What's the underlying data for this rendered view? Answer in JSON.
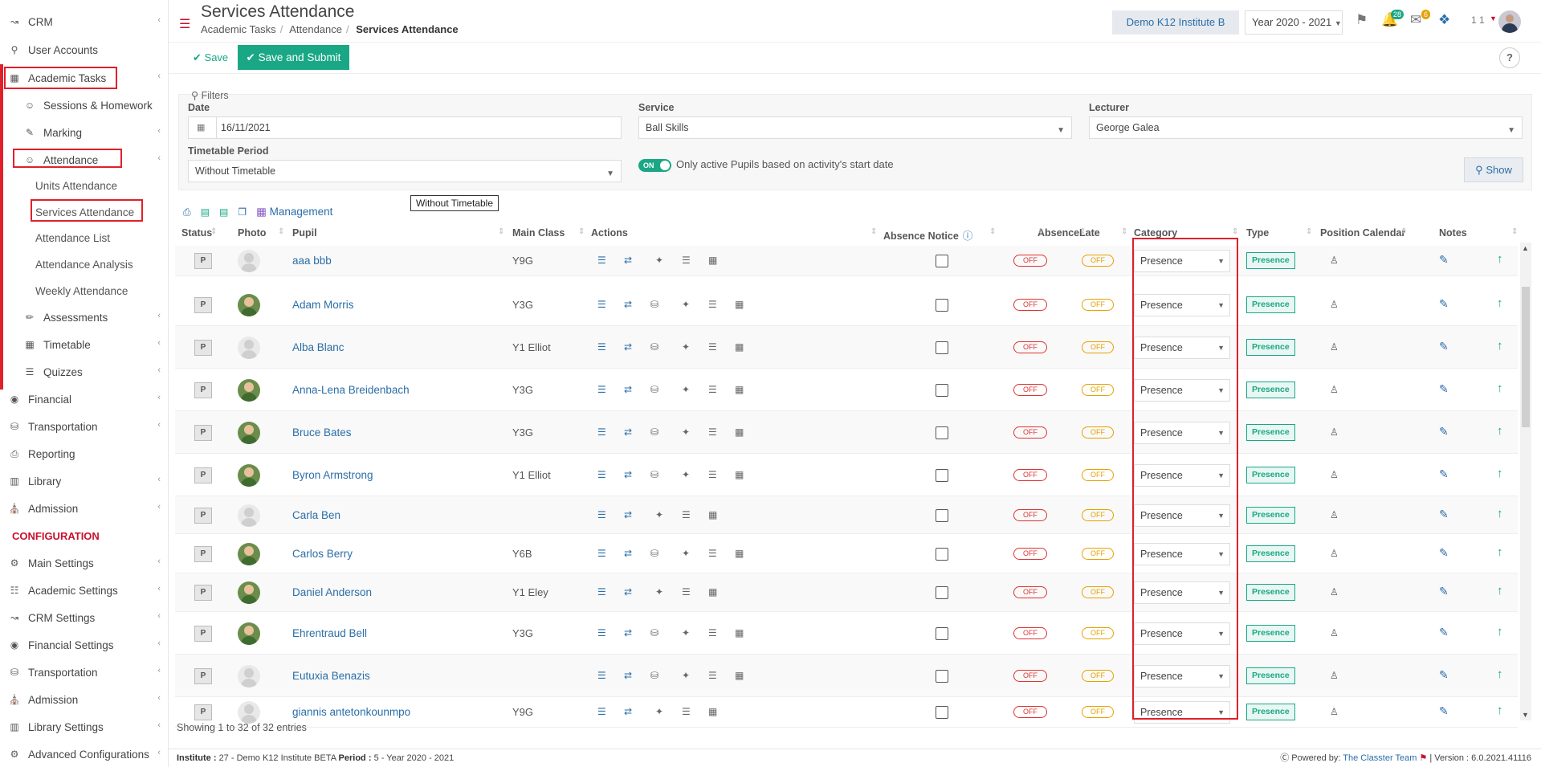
{
  "sidebar": {
    "items": [
      {
        "label": "CRM",
        "icon": "chart-icon",
        "chev": true
      },
      {
        "label": "User Accounts",
        "icon": "key-icon",
        "chev": false
      },
      {
        "label": "Academic Tasks",
        "icon": "grid-icon",
        "chev": true
      },
      {
        "label": "Sessions & Homework",
        "icon": "people-icon",
        "chev": false
      },
      {
        "label": "Marking",
        "icon": "edit-icon",
        "chev": true
      },
      {
        "label": "Attendance",
        "icon": "user-icon",
        "chev": true
      },
      {
        "label": "Units Attendance"
      },
      {
        "label": "Services Attendance"
      },
      {
        "label": "Attendance List"
      },
      {
        "label": "Attendance Analysis"
      },
      {
        "label": "Weekly Attendance"
      },
      {
        "label": "Assessments",
        "icon": "pen-icon",
        "chev": true
      },
      {
        "label": "Timetable",
        "icon": "calendar-icon",
        "chev": true
      },
      {
        "label": "Quizzes",
        "icon": "list-icon",
        "chev": true
      },
      {
        "label": "Financial",
        "icon": "coins-icon",
        "chev": true
      },
      {
        "label": "Transportation",
        "icon": "bus-icon",
        "chev": true
      },
      {
        "label": "Reporting",
        "icon": "printer-icon",
        "chev": false
      },
      {
        "label": "Library",
        "icon": "books-icon",
        "chev": true
      },
      {
        "label": "Admission",
        "icon": "bank-icon",
        "chev": true
      },
      {
        "label": "CONFIGURATION"
      },
      {
        "label": "Main Settings",
        "icon": "settings-icon",
        "chev": true
      },
      {
        "label": "Academic Settings",
        "icon": "org-icon",
        "chev": true
      },
      {
        "label": "CRM Settings",
        "icon": "chart-icon",
        "chev": true
      },
      {
        "label": "Financial Settings",
        "icon": "coins-icon",
        "chev": true
      },
      {
        "label": "Transportation",
        "icon": "bus-icon",
        "chev": true
      },
      {
        "label": "Admission",
        "icon": "bank-icon",
        "chev": true
      },
      {
        "label": "Library Settings",
        "icon": "books-icon",
        "chev": true
      },
      {
        "label": "Advanced Configurations",
        "icon": "settings-icon",
        "chev": true
      }
    ]
  },
  "header": {
    "title": "Services Attendance",
    "breadcrumb": [
      "Academic Tasks",
      "Attendance",
      "Services Attendance"
    ],
    "institute": "Demo K12 Institute B",
    "year": "Year 2020 - 2021",
    "notif_count": "28",
    "mail_count": "6",
    "user_label": "1 1"
  },
  "toolbar": {
    "save_label": "Save",
    "submit_label": "Save and Submit",
    "help_label": "?"
  },
  "filters": {
    "title": "Filters",
    "date_label": "Date",
    "date_value": "16/11/2021",
    "service_label": "Service",
    "service_value": "Ball Skills",
    "lecturer_label": "Lecturer",
    "lecturer_value": "George Galea",
    "period_label": "Timetable Period",
    "period_value": "Without Timetable",
    "toggle_text": "ON",
    "toggle_label": "Only active Pupils based on activity's start date",
    "show_label": "Show",
    "tooltip": "Without Timetable"
  },
  "tools": {
    "management_label": "Management"
  },
  "table": {
    "headers": [
      "Status",
      "Photo",
      "Pupil",
      "Main Class",
      "Actions",
      "Absence Notice",
      "Absence",
      "Late",
      "Category",
      "Type",
      "Position Calendar",
      "Notes"
    ],
    "rows": [
      {
        "status": "P",
        "name": "aaa bbb",
        "class": "Y9G",
        "photo": false,
        "bus": false,
        "category": "Presence",
        "type": "Presence"
      },
      {
        "status": "P",
        "name": "Adam Morris",
        "class": "Y3G",
        "photo": true,
        "bus": true,
        "category": "Presence",
        "type": "Presence"
      },
      {
        "status": "P",
        "name": "Alba Blanc",
        "class": "Y1 Elliot",
        "photo": false,
        "bus": true,
        "category": "Presence",
        "type": "Presence"
      },
      {
        "status": "P",
        "name": "Anna-Lena Breidenbach",
        "class": "Y3G",
        "photo": true,
        "bus": true,
        "category": "Presence",
        "type": "Presence"
      },
      {
        "status": "P",
        "name": "Bruce Bates",
        "class": "Y3G",
        "photo": true,
        "bus": true,
        "category": "Presence",
        "type": "Presence"
      },
      {
        "status": "P",
        "name": "Byron Armstrong",
        "class": "Y1 Elliot",
        "photo": true,
        "bus": true,
        "category": "Presence",
        "type": "Presence"
      },
      {
        "status": "P",
        "name": "Carla Ben",
        "class": "",
        "photo": false,
        "bus": false,
        "category": "Presence",
        "type": "Presence"
      },
      {
        "status": "P",
        "name": "Carlos Berry",
        "class": "Y6B",
        "photo": true,
        "bus": true,
        "category": "Presence",
        "type": "Presence"
      },
      {
        "status": "P",
        "name": "Daniel Anderson",
        "class": "Y1 Eley",
        "photo": true,
        "bus": false,
        "category": "Presence",
        "type": "Presence"
      },
      {
        "status": "P",
        "name": "Ehrentraud Bell",
        "class": "Y3G",
        "photo": true,
        "bus": true,
        "category": "Presence",
        "type": "Presence"
      },
      {
        "status": "P",
        "name": "Eutuxia Benazis",
        "class": "",
        "photo": false,
        "bus": true,
        "category": "Presence",
        "type": "Presence"
      },
      {
        "status": "P",
        "name": "giannis antetonkounmpo",
        "class": "Y9G",
        "photo": false,
        "bus": false,
        "category": "Presence",
        "type": "Presence"
      }
    ],
    "off_label": "OFF",
    "showing": "Showing 1 to 32 of 32 entries"
  },
  "footer": {
    "institute_label": "Institute :",
    "institute_value": "27 - Demo K12 Institute BETA",
    "period_label": "Period :",
    "period_value": "5 - Year 2020 - 2021",
    "powered": "Powered by:",
    "team": "The Classter Team",
    "version": "| Version : 6.0.2021.41116"
  }
}
